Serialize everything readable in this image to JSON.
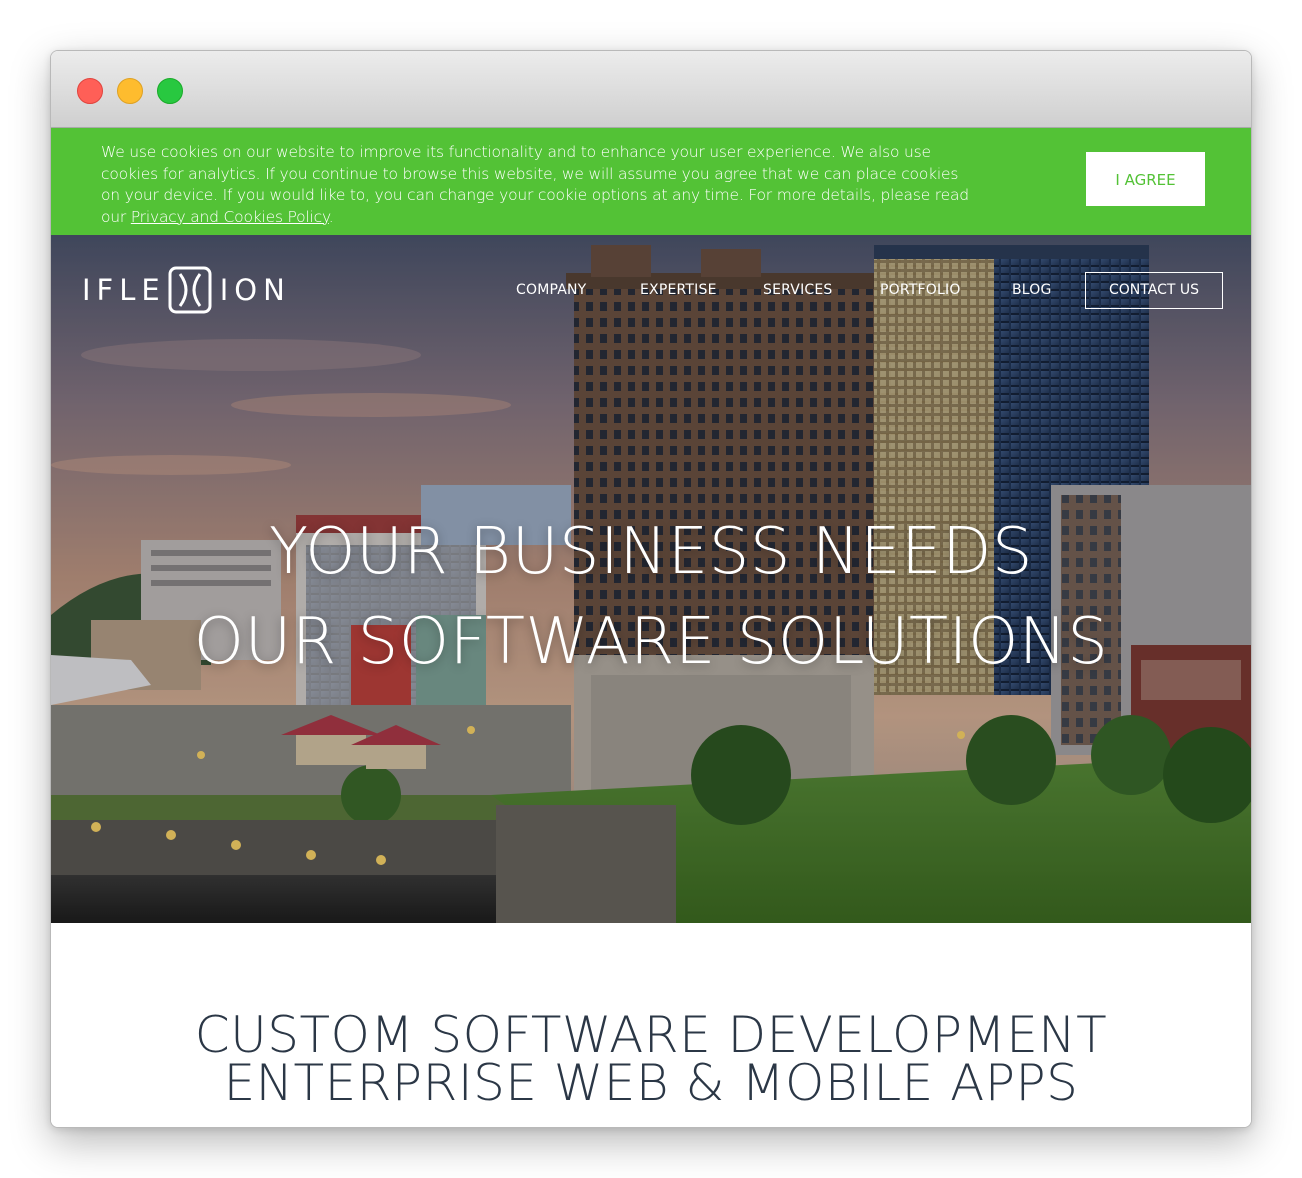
{
  "cookie_banner": {
    "text": "We use cookies on our website to improve its functionality and to enhance your user experience. We also use cookies for analytics. If you continue to browse this website, we will assume you agree that we can place cookies on your device. If you would like to, you can change your cookie options at any time. For more details, please read our ",
    "policy_link": "Privacy and Cookies Policy",
    "text_end": ".",
    "agree_label": "I AGREE"
  },
  "logo": {
    "left": "IFLE",
    "right": "ION"
  },
  "nav": {
    "items": [
      "COMPANY",
      "EXPERTISE",
      "SERVICES",
      "PORTFOLIO",
      "BLOG"
    ],
    "contact_label": "CONTACT US"
  },
  "hero": {
    "line1": "YOUR BUSINESS NEEDS",
    "line2": "OUR SOFTWARE SOLUTIONS"
  },
  "section": {
    "line1": "CUSTOM SOFTWARE DEVELOPMENT",
    "line2": "ENTERPRISE WEB & MOBILE APPS"
  },
  "colors": {
    "banner_green": "#53c236",
    "heading_dark": "#2b3746"
  }
}
